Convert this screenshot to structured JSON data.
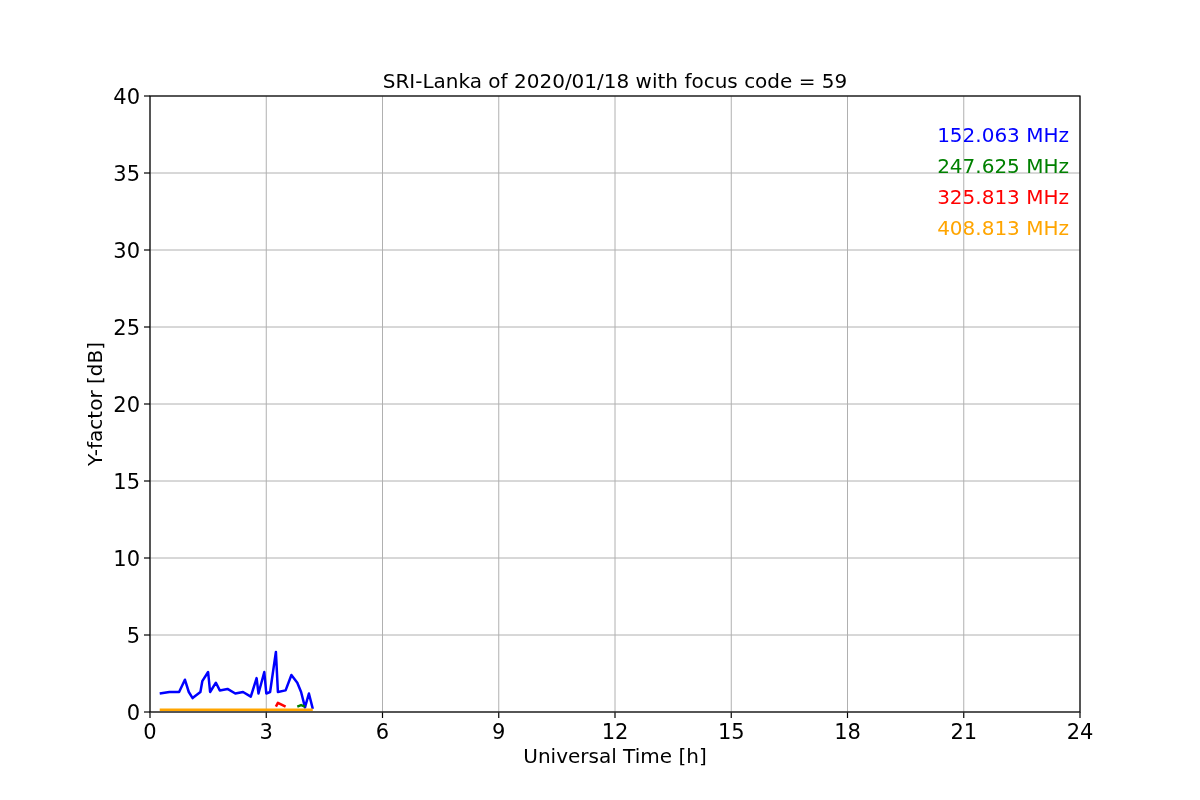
{
  "figure": {
    "chart_data": {
      "type": "line",
      "title": "SRI-Lanka of 2020/01/18 with focus code = 59",
      "xlabel": "Universal Time [h]",
      "ylabel": "Y-factor [dB]",
      "x": [
        0.25,
        0.5,
        0.75,
        0.9,
        1.0,
        1.1,
        1.3,
        1.35,
        1.5,
        1.55,
        1.7,
        1.8,
        2.0,
        2.2,
        2.4,
        2.6,
        2.75,
        2.8,
        2.95,
        3.0,
        3.1,
        3.25,
        3.3,
        3.5,
        3.65,
        3.8,
        3.9,
        4.0,
        4.1,
        4.2
      ],
      "series": [
        {
          "name": "152.063 MHz",
          "color": "#0000ff",
          "values": [
            1.2,
            1.3,
            1.3,
            2.1,
            1.3,
            0.9,
            1.3,
            2.0,
            2.6,
            1.3,
            1.9,
            1.4,
            1.5,
            1.2,
            1.3,
            1.0,
            2.2,
            1.2,
            2.6,
            1.2,
            1.3,
            3.9,
            1.3,
            1.4,
            2.4,
            1.9,
            1.3,
            0.3,
            1.2,
            0.2
          ]
        },
        {
          "name": "247.625 MHz",
          "color": "#008000",
          "values": [
            null,
            null,
            null,
            null,
            null,
            null,
            null,
            null,
            null,
            null,
            null,
            null,
            null,
            null,
            null,
            null,
            null,
            null,
            null,
            null,
            null,
            null,
            null,
            null,
            null,
            0.35,
            0.45,
            0.35,
            null,
            null
          ]
        },
        {
          "name": "325.813 MHz",
          "color": "#ff0000",
          "values": [
            null,
            null,
            null,
            null,
            null,
            null,
            null,
            null,
            null,
            null,
            null,
            null,
            null,
            null,
            null,
            null,
            null,
            null,
            null,
            null,
            null,
            0.35,
            0.6,
            0.35,
            null,
            null,
            null,
            null,
            null,
            null
          ]
        },
        {
          "name": "408.813 MHz",
          "color": "#ffa500",
          "values": [
            0.15,
            0.15,
            0.15,
            0.15,
            0.15,
            0.15,
            0.15,
            0.15,
            0.15,
            0.15,
            0.15,
            0.15,
            0.15,
            0.15,
            0.15,
            0.15,
            0.15,
            0.15,
            0.15,
            0.15,
            0.15,
            0.15,
            0.15,
            0.15,
            0.15,
            0.15,
            0.15,
            0.15,
            0.15,
            0.15
          ]
        }
      ],
      "grid": true,
      "xlim": [
        0,
        24
      ],
      "ylim": [
        0,
        40
      ],
      "xticks": [
        0,
        3,
        6,
        9,
        12,
        15,
        18,
        21,
        24
      ],
      "yticks": [
        0,
        5,
        10,
        15,
        20,
        25,
        30,
        35,
        40
      ]
    }
  }
}
